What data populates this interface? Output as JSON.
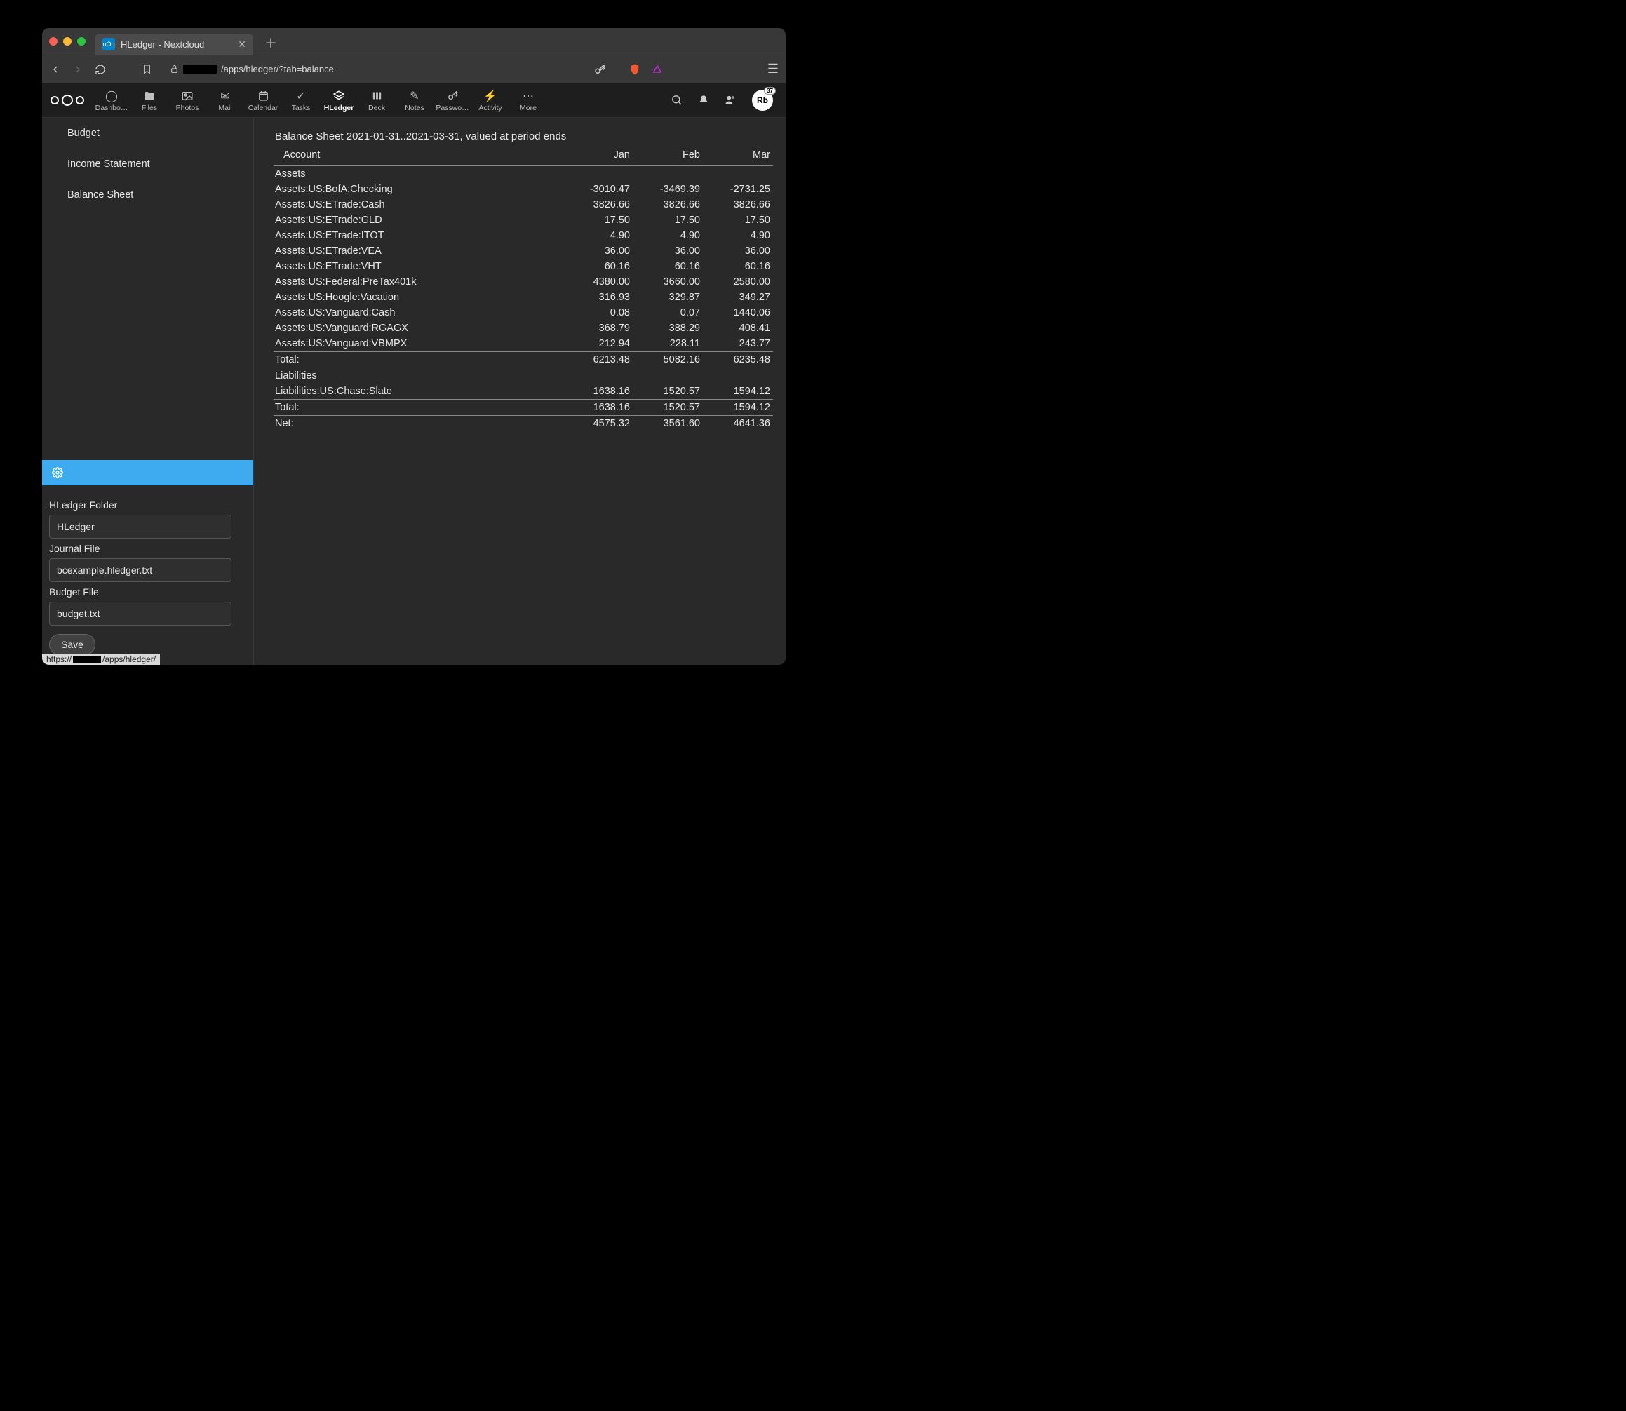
{
  "browser": {
    "tab_title": "HLedger - Nextcloud",
    "url_path": "/apps/hledger/?tab=balance",
    "status_url_prefix": "https://",
    "status_url_path": "/apps/hledger/"
  },
  "nc": {
    "apps": [
      {
        "label": "Dashbo…",
        "icon": "◯"
      },
      {
        "label": "Files",
        "icon": "folder"
      },
      {
        "label": "Photos",
        "icon": "image"
      },
      {
        "label": "Mail",
        "icon": "✉"
      },
      {
        "label": "Calendar",
        "icon": "cal"
      },
      {
        "label": "Tasks",
        "icon": "✓"
      },
      {
        "label": "HLedger",
        "icon": "stack",
        "active": true
      },
      {
        "label": "Deck",
        "icon": "deck"
      },
      {
        "label": "Notes",
        "icon": "✎"
      },
      {
        "label": "Passwo…",
        "icon": "key"
      },
      {
        "label": "Activity",
        "icon": "⚡"
      },
      {
        "label": "More",
        "icon": "⋯"
      }
    ],
    "avatar_text": "Rb",
    "avatar_badge": "37"
  },
  "sidebar": {
    "items": [
      {
        "label": "Budget"
      },
      {
        "label": "Income Statement"
      },
      {
        "label": "Balance Sheet"
      }
    ],
    "settings": {
      "folder_label": "HLedger Folder",
      "folder_value": "HLedger",
      "journal_label": "Journal File",
      "journal_value": "bcexample.hledger.txt",
      "budget_label": "Budget File",
      "budget_value": "budget.txt",
      "save_label": "Save"
    }
  },
  "sheet": {
    "title": "Balance Sheet 2021-01-31..2021-03-31, valued at period ends",
    "col_account": "Account",
    "cols": [
      "Jan",
      "Feb",
      "Mar"
    ],
    "sections": [
      {
        "name": "Assets",
        "rows": [
          {
            "a": "Assets:US:BofA:Checking",
            "v": [
              "-3010.47",
              "-3469.39",
              "-2731.25"
            ]
          },
          {
            "a": "Assets:US:ETrade:Cash",
            "v": [
              "3826.66",
              "3826.66",
              "3826.66"
            ]
          },
          {
            "a": "Assets:US:ETrade:GLD",
            "v": [
              "17.50",
              "17.50",
              "17.50"
            ]
          },
          {
            "a": "Assets:US:ETrade:ITOT",
            "v": [
              "4.90",
              "4.90",
              "4.90"
            ]
          },
          {
            "a": "Assets:US:ETrade:VEA",
            "v": [
              "36.00",
              "36.00",
              "36.00"
            ]
          },
          {
            "a": "Assets:US:ETrade:VHT",
            "v": [
              "60.16",
              "60.16",
              "60.16"
            ]
          },
          {
            "a": "Assets:US:Federal:PreTax401k",
            "v": [
              "4380.00",
              "3660.00",
              "2580.00"
            ]
          },
          {
            "a": "Assets:US:Hoogle:Vacation",
            "v": [
              "316.93",
              "329.87",
              "349.27"
            ]
          },
          {
            "a": "Assets:US:Vanguard:Cash",
            "v": [
              "0.08",
              "0.07",
              "1440.06"
            ]
          },
          {
            "a": "Assets:US:Vanguard:RGAGX",
            "v": [
              "368.79",
              "388.29",
              "408.41"
            ]
          },
          {
            "a": "Assets:US:Vanguard:VBMPX",
            "v": [
              "212.94",
              "228.11",
              "243.77"
            ]
          }
        ],
        "total_label": "Total:",
        "total": [
          "6213.48",
          "5082.16",
          "6235.48"
        ]
      },
      {
        "name": "Liabilities",
        "rows": [
          {
            "a": "Liabilities:US:Chase:Slate",
            "v": [
              "1638.16",
              "1520.57",
              "1594.12"
            ]
          }
        ],
        "total_label": "Total:",
        "total": [
          "1638.16",
          "1520.57",
          "1594.12"
        ]
      }
    ],
    "net_label": "Net:",
    "net": [
      "4575.32",
      "3561.60",
      "4641.36"
    ]
  }
}
